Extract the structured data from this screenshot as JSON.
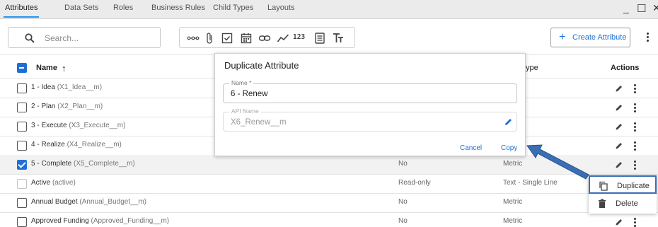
{
  "tabs": [
    {
      "label": "Attributes",
      "active": true
    },
    {
      "label": "Data Sets"
    },
    {
      "label": "Roles"
    },
    {
      "label": "Business Rules"
    },
    {
      "label": "Child Types"
    },
    {
      "label": "Layouts"
    }
  ],
  "window": {
    "minimize": "_",
    "maximize": "☐",
    "close": "✕"
  },
  "search": {
    "placeholder": "Search..."
  },
  "toolbar": {
    "filter_icons": [
      "sequence-icon",
      "attachment-icon",
      "checkbox-icon",
      "date-icon",
      "link-icon",
      "trend-icon",
      "number-icon",
      "form-icon",
      "text-format-icon"
    ],
    "number_glyph": "123",
    "create_label": "Create Attribute",
    "create_glyph": "+"
  },
  "table": {
    "headers": {
      "name": "Name",
      "sort": "↑",
      "type": "ype",
      "actions": "Actions"
    },
    "rows": [
      {
        "name": "1 - Idea",
        "api": "(X1_Idea__m)",
        "col2": "",
        "col3": "",
        "checked": false
      },
      {
        "name": "2 - Plan",
        "api": "(X2_Plan__m)",
        "col2": "",
        "col3": "",
        "checked": false
      },
      {
        "name": "3 - Execute",
        "api": "(X3_Execute__m)",
        "col2": "",
        "col3": "",
        "checked": false
      },
      {
        "name": "4 - Realize",
        "api": "(X4_Realize__m)",
        "col2": "",
        "col3": "",
        "checked": false
      },
      {
        "name": "5 - Complete",
        "api": "(X5_Complete__m)",
        "col2": "No",
        "col3": "Metric",
        "checked": true
      },
      {
        "name": "Active",
        "api": "(active)",
        "col2": "Read-only",
        "col3": "Text - Single Line",
        "checked": false,
        "disabled": true
      },
      {
        "name": "Annual Budget",
        "api": "(Annual_Budget__m)",
        "col2": "No",
        "col3": "Metric",
        "checked": false
      },
      {
        "name": "Approved Funding",
        "api": "(Approved_Funding__m)",
        "col2": "No",
        "col3": "Metric",
        "checked": false
      }
    ]
  },
  "dialog": {
    "title": "Duplicate Attribute",
    "name_label": "Name *",
    "name_value": "6 - Renew",
    "api_label": "API Name",
    "api_value": "X6_Renew__m",
    "cancel": "Cancel",
    "copy": "Copy"
  },
  "context_menu": {
    "duplicate": "Duplicate",
    "delete": "Delete"
  },
  "colors": {
    "accent": "#1f6fd6",
    "arrow": "#3a6fb3",
    "tab_underline": "#2196f3"
  }
}
